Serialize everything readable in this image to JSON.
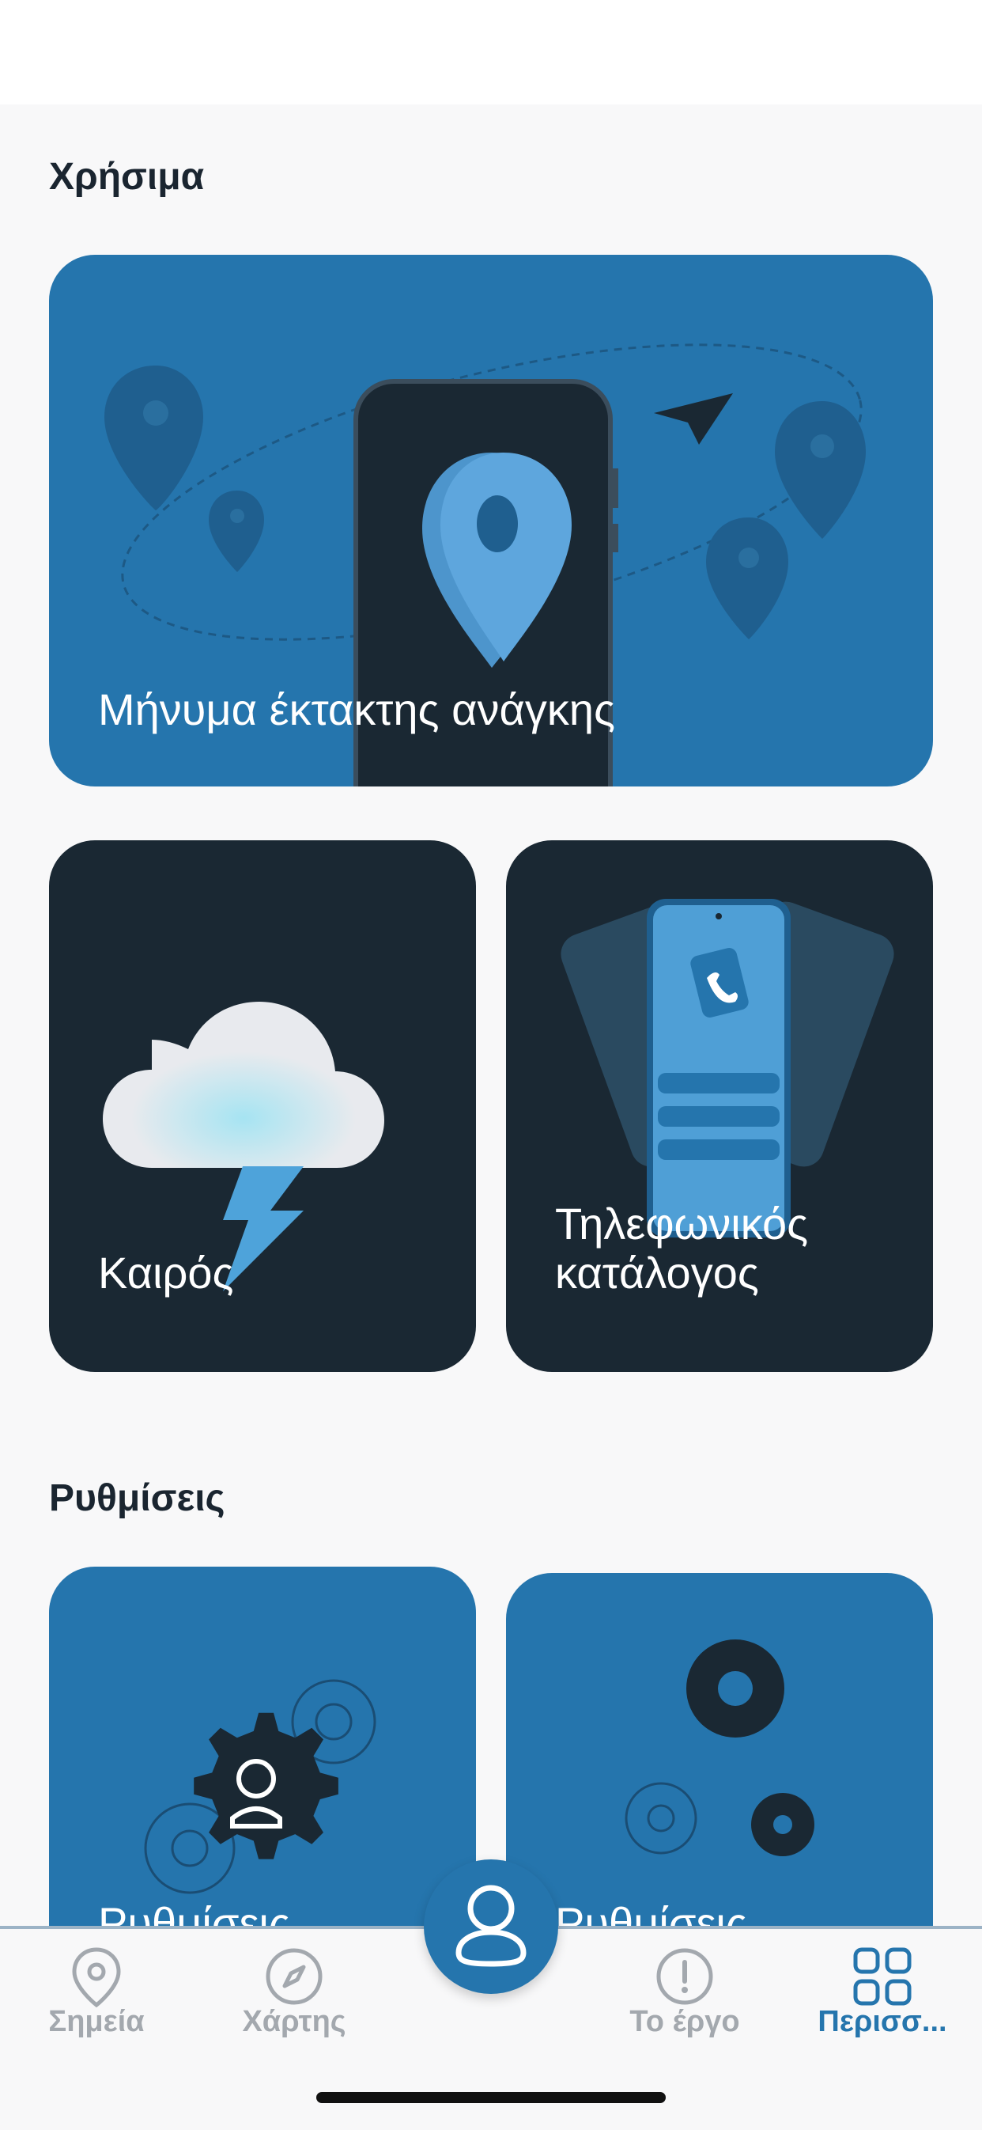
{
  "sections": {
    "useful_title": "Χρήσιμα",
    "settings_title": "Ρυθμίσεις"
  },
  "cards": {
    "emergency": "Μήνυμα έκτακτης ανάγκης",
    "weather": "Καιρός",
    "phonebook_line1": "Τηλεφωνικός",
    "phonebook_line2": "κατάλογος",
    "settings_user": "Ρυθμίσεις",
    "settings_app": "Ρυθμίσεις"
  },
  "tabs": [
    {
      "label": "Σημεία",
      "icon": "location-pin-icon",
      "active": false
    },
    {
      "label": "Χάρτης",
      "icon": "compass-icon",
      "active": false
    },
    {
      "label": "Το έργο",
      "icon": "alert-circle-icon",
      "active": false
    },
    {
      "label": "Περισσ...",
      "icon": "grid-icon",
      "active": true
    }
  ],
  "fab": {
    "icon": "user-icon"
  },
  "colors": {
    "primary": "#2575ad",
    "dark": "#1a2833",
    "background": "#f8f8f9",
    "tab_inactive": "#a3a8ae"
  }
}
